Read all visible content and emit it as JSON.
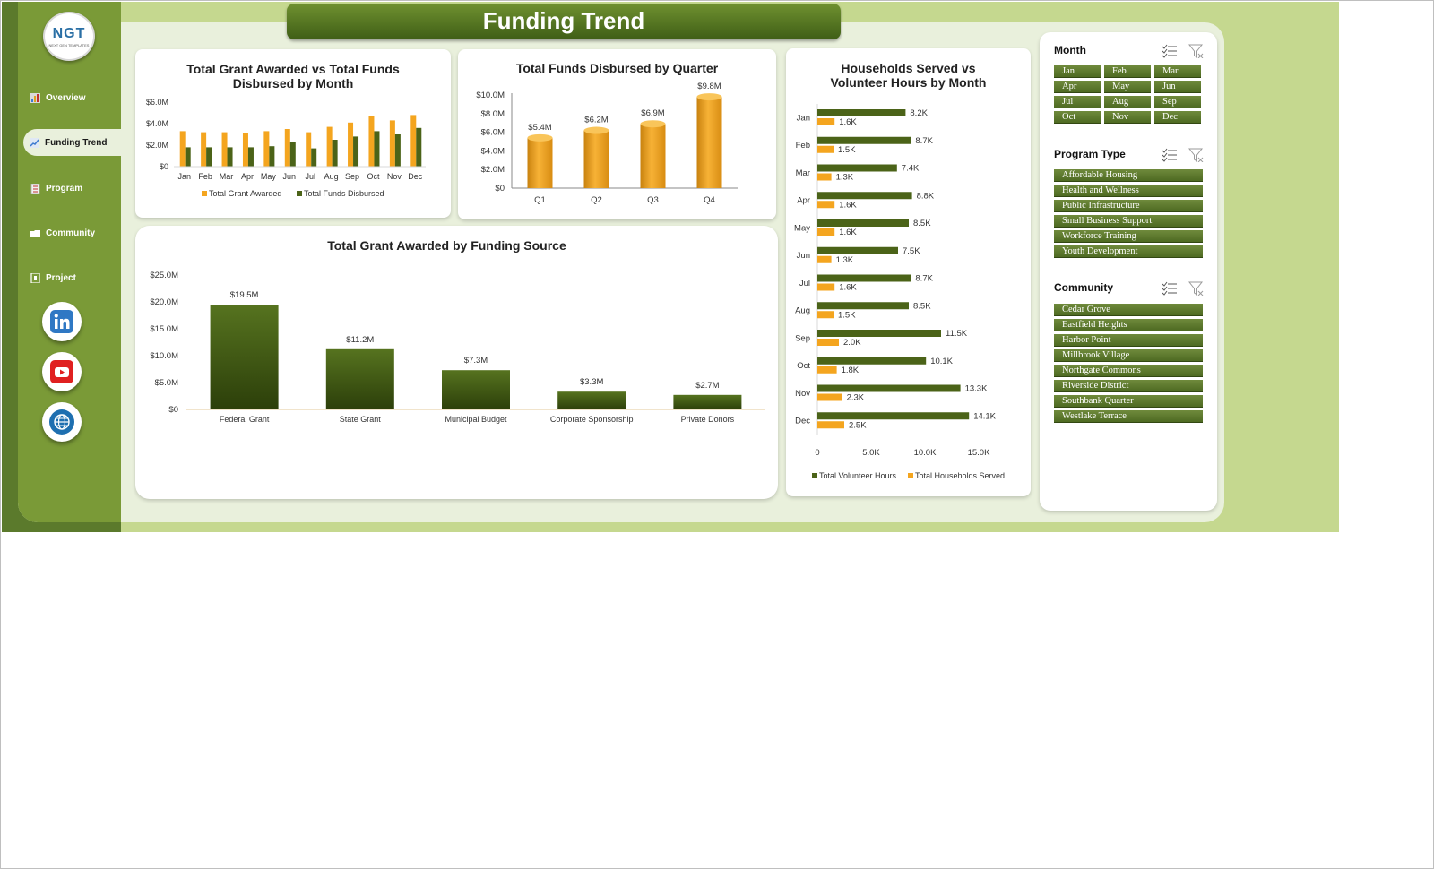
{
  "header": {
    "title": "Funding Trend"
  },
  "logo": {
    "text": "NGT",
    "subtext": "NEXT GEN TEMPLATES"
  },
  "nav": [
    {
      "label": "Overview",
      "icon": "overview-icon",
      "active": false
    },
    {
      "label": "Funding Trend",
      "icon": "trend-icon",
      "active": true
    },
    {
      "label": "Program",
      "icon": "program-icon",
      "active": false
    },
    {
      "label": "Community",
      "icon": "folder-icon",
      "active": false
    },
    {
      "label": "Project",
      "icon": "project-icon",
      "active": false
    }
  ],
  "social": [
    {
      "name": "linkedin",
      "icon": "linkedin-icon",
      "color": "#2f78c4"
    },
    {
      "name": "youtube",
      "icon": "youtube-icon",
      "color": "#e02020"
    },
    {
      "name": "website",
      "icon": "globe-icon",
      "color": "#1e6fb0"
    }
  ],
  "colors": {
    "orange": "#f4a51f",
    "olive": "#4b6318",
    "sidebar": "#7a9a37",
    "panel": "#e9f0dc",
    "background": "#c5d88f"
  },
  "chart_data": [
    {
      "id": "monthly",
      "type": "bar",
      "title": "Total Grant Awarded vs Total Funds Disbursed by Month",
      "categories": [
        "Jan",
        "Feb",
        "Mar",
        "Apr",
        "May",
        "Jun",
        "Jul",
        "Aug",
        "Sep",
        "Oct",
        "Nov",
        "Dec"
      ],
      "series": [
        {
          "name": "Total Grant Awarded",
          "color": "#f4a51f",
          "values": [
            3.3,
            3.2,
            3.2,
            3.1,
            3.3,
            3.5,
            3.2,
            3.7,
            4.1,
            4.7,
            4.3,
            4.8
          ]
        },
        {
          "name": "Total Funds Disbursed",
          "color": "#4b6318",
          "values": [
            1.8,
            1.8,
            1.8,
            1.8,
            1.9,
            2.3,
            1.7,
            2.5,
            2.8,
            3.3,
            3.0,
            3.6
          ]
        }
      ],
      "yticks": [
        "$0",
        "$2.0M",
        "$4.0M",
        "$6.0M"
      ],
      "ylim": [
        0,
        6
      ],
      "legend": "bottom"
    },
    {
      "id": "quarterly",
      "type": "bar",
      "title": "Total Funds Disbursed by Quarter",
      "categories": [
        "Q1",
        "Q2",
        "Q3",
        "Q4"
      ],
      "values": [
        5.4,
        6.2,
        6.9,
        9.8
      ],
      "labels": [
        "$5.4M",
        "$6.2M",
        "$6.9M",
        "$9.8M"
      ],
      "yticks": [
        "$0",
        "$2.0M",
        "$4.0M",
        "$6.0M",
        "$8.0M",
        "$10.0M"
      ],
      "ylim": [
        0,
        10
      ],
      "color": "#f4a51f"
    },
    {
      "id": "source",
      "type": "bar",
      "title": "Total Grant Awarded by Funding Source",
      "categories": [
        "Federal Grant",
        "State Grant",
        "Municipal Budget",
        "Corporate Sponsorship",
        "Private Donors"
      ],
      "values": [
        19.5,
        11.2,
        7.3,
        3.3,
        2.7
      ],
      "labels": [
        "$19.5M",
        "$11.2M",
        "$7.3M",
        "$3.3M",
        "$2.7M"
      ],
      "yticks": [
        "$0",
        "$5.0M",
        "$10.0M",
        "$15.0M",
        "$20.0M",
        "$25.0M"
      ],
      "ylim": [
        0,
        25
      ],
      "color": "#3f5514"
    },
    {
      "id": "households",
      "type": "bar",
      "orientation": "horizontal",
      "title": "Households Served vs Volunteer Hours by Month",
      "categories": [
        "Jan",
        "Feb",
        "Mar",
        "Apr",
        "May",
        "Jun",
        "Jul",
        "Aug",
        "Sep",
        "Oct",
        "Nov",
        "Dec"
      ],
      "series": [
        {
          "name": "Total Volunteer Hours",
          "color": "#4b6318",
          "values": [
            8.2,
            8.7,
            7.4,
            8.8,
            8.5,
            7.5,
            8.7,
            8.5,
            11.5,
            10.1,
            13.3,
            14.1
          ],
          "labels": [
            "8.2K",
            "8.7K",
            "7.4K",
            "8.8K",
            "8.5K",
            "7.5K",
            "8.7K",
            "8.5K",
            "11.5K",
            "10.1K",
            "13.3K",
            "14.1K"
          ]
        },
        {
          "name": "Total Households Served",
          "color": "#f4a51f",
          "values": [
            1.6,
            1.5,
            1.3,
            1.6,
            1.6,
            1.3,
            1.6,
            1.5,
            2.0,
            1.8,
            2.3,
            2.5
          ],
          "labels": [
            "1.6K",
            "1.5K",
            "1.3K",
            "1.6K",
            "1.6K",
            "1.3K",
            "1.6K",
            "1.5K",
            "2.0K",
            "1.8K",
            "2.3K",
            "2.5K"
          ]
        }
      ],
      "xticks": [
        "0",
        "5.0K",
        "10.0K",
        "15.0K"
      ],
      "xlim": [
        0,
        15
      ],
      "legend": "bottom"
    }
  ],
  "slicers": {
    "month": {
      "title": "Month",
      "items": [
        "Jan",
        "Feb",
        "Mar",
        "Apr",
        "May",
        "Jun",
        "Jul",
        "Aug",
        "Sep",
        "Oct",
        "Nov",
        "Dec"
      ]
    },
    "program": {
      "title": "Program Type",
      "items": [
        "Affordable Housing",
        "Health and Wellness",
        "Public Infrastructure",
        "Small Business Support",
        "Workforce Training",
        "Youth Development"
      ]
    },
    "community": {
      "title": "Community",
      "items": [
        "Cedar Grove",
        "Eastfield Heights",
        "Harbor Point",
        "Millbrook Village",
        "Northgate Commons",
        "Riverside District",
        "Southbank Quarter",
        "Westlake Terrace"
      ]
    }
  }
}
